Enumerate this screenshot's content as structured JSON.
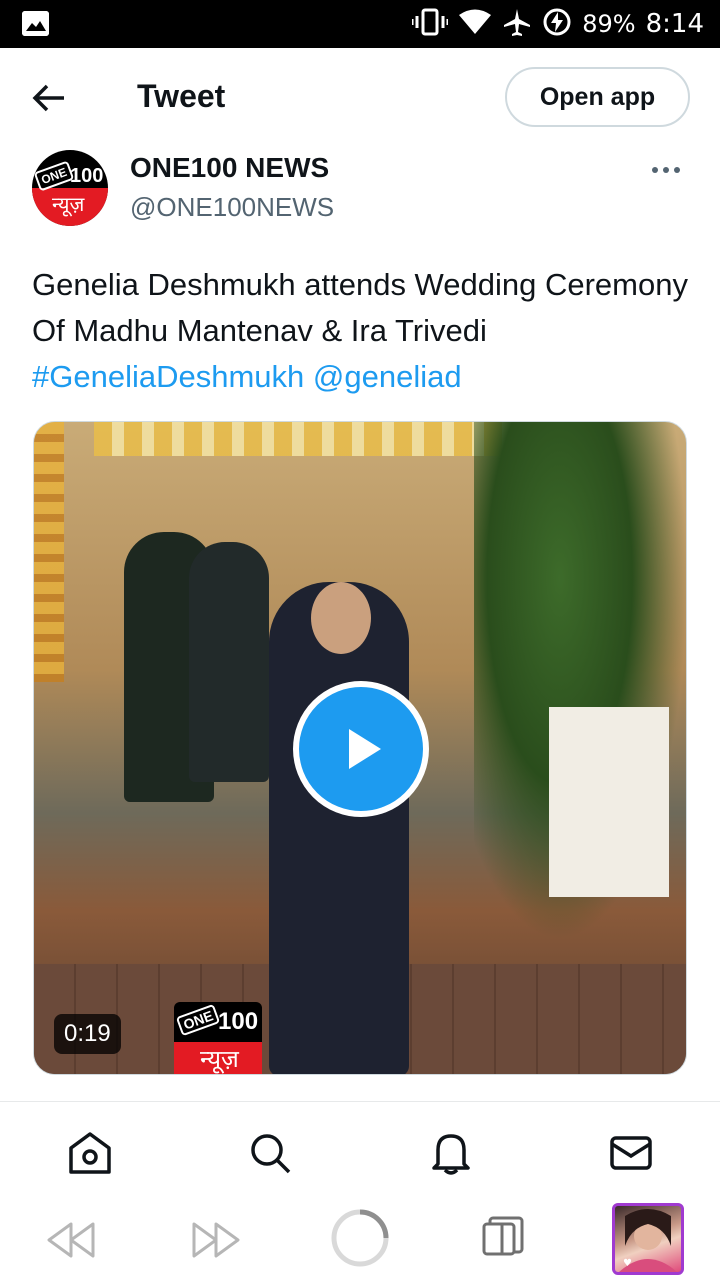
{
  "status_bar": {
    "battery": "89%",
    "time": "8:14",
    "icons": [
      "gallery-icon",
      "vibrate-icon",
      "wifi-icon",
      "airplane-icon",
      "battery-charging-icon"
    ]
  },
  "header": {
    "title": "Tweet",
    "open_app_label": "Open app",
    "back_icon": "arrow-left-icon"
  },
  "tweet": {
    "author": {
      "display_name": "ONE100 NEWS",
      "handle": "@ONE100NEWS",
      "avatar_text_one": "ONE",
      "avatar_text_num": "100",
      "avatar_text_hindi": "न्यूज़"
    },
    "text": "Genelia Deshmukh attends Wedding Ceremony Of Madhu Mantenav & Ira Trivedi",
    "hashtag": "#GeneliaDeshmukh",
    "mention": "@geneliad",
    "video": {
      "duration": "0:19",
      "watermark_one": "ONE",
      "watermark_num": "100",
      "watermark_hindi": "न्यूज़"
    }
  },
  "bottom_nav": {
    "items": [
      "home-icon",
      "search-icon",
      "notifications-icon",
      "messages-icon"
    ]
  },
  "browser_bar": {
    "items": [
      "rewind-icon",
      "fast-forward-icon",
      "loading-icon",
      "tabs-icon",
      "profile-avatar"
    ]
  },
  "colors": {
    "accent": "#1d9bf0",
    "text": "#0f1419",
    "secondary": "#536471"
  }
}
